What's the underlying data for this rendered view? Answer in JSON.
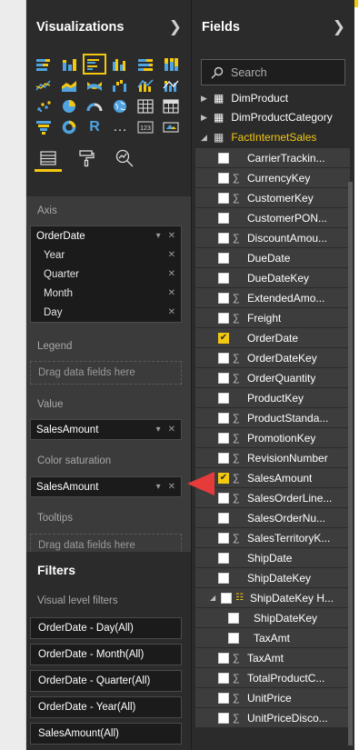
{
  "visualizations": {
    "title": "Visualizations",
    "collapse_icon": "chevron-right-icon",
    "icons": [
      "stacked-bar-icon",
      "stacked-column-icon",
      "clustered-bar-icon",
      "clustered-column-icon",
      "100-bar-icon",
      "100-column-icon",
      "line-chart-icon",
      "area-chart-icon",
      "ribbon-chart-icon",
      "waterfall-icon",
      "line-column-icon",
      "line-stacked-icon",
      "scatter-icon",
      "pie-icon",
      "gauge-icon",
      "map-icon",
      "table-icon",
      "matrix-icon",
      "funnel-icon",
      "donut-icon",
      "r-script-icon",
      "more-icon",
      "card-icon",
      "slicer-icon"
    ],
    "icon_text": {
      "r": "R",
      "more": "…",
      "card": "123"
    },
    "tabs": [
      "fields-tab-icon",
      "format-tab-icon",
      "analytics-tab-icon"
    ],
    "axis_label": "Axis",
    "axis_field": "OrderDate",
    "axis_children": [
      "Year",
      "Quarter",
      "Month",
      "Day"
    ],
    "legend_label": "Legend",
    "drop_placeholder": "Drag data fields here",
    "value_label": "Value",
    "value_field": "SalesAmount",
    "color_saturation_label": "Color saturation",
    "color_saturation_field": "SalesAmount",
    "tooltips_label": "Tooltips",
    "tooltips_placeholder": "Drag data fields here"
  },
  "filters": {
    "title": "Filters",
    "visual_level_label": "Visual level filters",
    "items": [
      "OrderDate - Day(All)",
      "OrderDate - Month(All)",
      "OrderDate - Quarter(All)",
      "OrderDate - Year(All)",
      "SalesAmount(All)"
    ]
  },
  "fields_pane": {
    "title": "Fields",
    "collapse_icon": "chevron-right-icon",
    "search_placeholder": "Search",
    "tables": [
      "DimProduct",
      "DimProductCategory",
      "FactInternetSales"
    ],
    "fields": [
      {
        "name": "CarrierTrackin...",
        "sigma": false,
        "checked": false
      },
      {
        "name": "CurrencyKey",
        "sigma": true,
        "checked": false
      },
      {
        "name": "CustomerKey",
        "sigma": true,
        "checked": false
      },
      {
        "name": "CustomerPON...",
        "sigma": false,
        "checked": false
      },
      {
        "name": "DiscountAmou...",
        "sigma": true,
        "checked": false
      },
      {
        "name": "DueDate",
        "sigma": false,
        "checked": false
      },
      {
        "name": "DueDateKey",
        "sigma": false,
        "checked": false
      },
      {
        "name": "ExtendedAmo...",
        "sigma": true,
        "checked": false
      },
      {
        "name": "Freight",
        "sigma": true,
        "checked": false
      },
      {
        "name": "OrderDate",
        "sigma": false,
        "checked": true
      },
      {
        "name": "OrderDateKey",
        "sigma": true,
        "checked": false
      },
      {
        "name": "OrderQuantity",
        "sigma": true,
        "checked": false
      },
      {
        "name": "ProductKey",
        "sigma": false,
        "checked": false
      },
      {
        "name": "ProductStanda...",
        "sigma": true,
        "checked": false
      },
      {
        "name": "PromotionKey",
        "sigma": true,
        "checked": false
      },
      {
        "name": "RevisionNumber",
        "sigma": true,
        "checked": false
      },
      {
        "name": "SalesAmount",
        "sigma": true,
        "checked": true
      },
      {
        "name": "SalesOrderLine...",
        "sigma": true,
        "checked": false
      },
      {
        "name": "SalesOrderNu...",
        "sigma": false,
        "checked": false
      },
      {
        "name": "SalesTerritoryK...",
        "sigma": true,
        "checked": false
      },
      {
        "name": "ShipDate",
        "sigma": false,
        "checked": false
      },
      {
        "name": "ShipDateKey",
        "sigma": false,
        "checked": false
      },
      {
        "name": "ShipDateKey H...",
        "sigma": false,
        "checked": false,
        "hierarchy": true
      },
      {
        "name": "ShipDateKey",
        "sigma": false,
        "checked": false,
        "child": true
      },
      {
        "name": "TaxAmt",
        "sigma": false,
        "checked": false,
        "child": true
      },
      {
        "name": "TaxAmt",
        "sigma": true,
        "checked": false
      },
      {
        "name": "TotalProductC...",
        "sigma": true,
        "checked": false
      },
      {
        "name": "UnitPrice",
        "sigma": true,
        "checked": false
      },
      {
        "name": "UnitPriceDisco...",
        "sigma": true,
        "checked": false
      }
    ]
  },
  "colors": {
    "accent": "#f2c811",
    "pane_bg": "#2b2b2b",
    "annotation_arrow": "#e63b3b"
  }
}
